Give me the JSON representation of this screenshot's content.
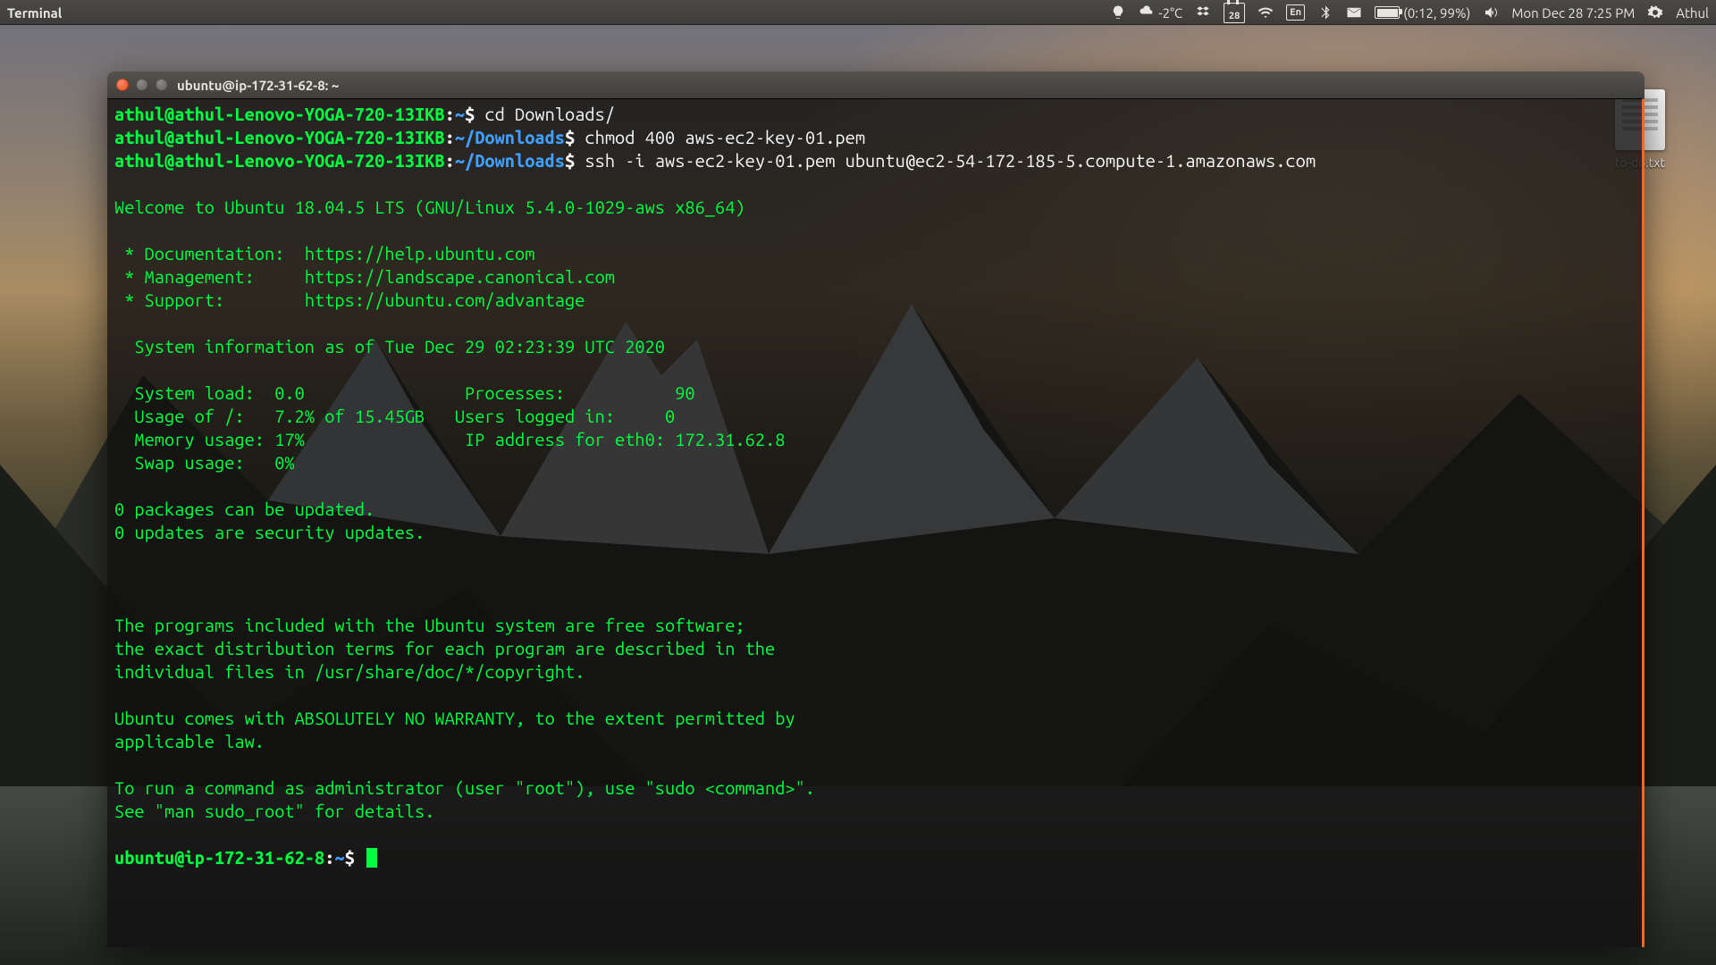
{
  "menubar": {
    "app_title": "Terminal",
    "indicators": {
      "temp": "-2°C",
      "calendar_day": "28",
      "kb_layout": "En",
      "battery_text": "(0:12, 99%)",
      "datetime": "Mon Dec 28  7:25 PM",
      "user": "Athul"
    }
  },
  "desktop": {
    "file_label": "to-do.txt"
  },
  "terminal": {
    "title": "ubuntu@ip-172-31-62-8: ~",
    "prompts": [
      {
        "user": "athul@athul-Lenovo-YOGA-720-13IKB",
        "path": "~",
        "cmd": "cd Downloads/"
      },
      {
        "user": "athul@athul-Lenovo-YOGA-720-13IKB",
        "path": "~/Downloads",
        "cmd": "chmod 400 aws-ec2-key-01.pem"
      },
      {
        "user": "athul@athul-Lenovo-YOGA-720-13IKB",
        "path": "~/Downloads",
        "cmd": "ssh -i aws-ec2-key-01.pem ubuntu@ec2-54-172-185-5.compute-1.amazonaws.com"
      }
    ],
    "motd": {
      "welcome": "Welcome to Ubuntu 18.04.5 LTS (GNU/Linux 5.4.0-1029-aws x86_64)",
      "links": {
        "doc_label": " * Documentation:",
        "doc_url": "https://help.ubuntu.com",
        "man_label": " * Management:",
        "man_url": "https://landscape.canonical.com",
        "sup_label": " * Support:",
        "sup_url": "https://ubuntu.com/advantage"
      },
      "sysinfo_header": "  System information as of Tue Dec 29 02:23:39 UTC 2020",
      "sysinfo": {
        "load_label": "  System load:",
        "load_val": "0.0",
        "proc_label": "Processes:",
        "proc_val": "90",
        "usage_label": "  Usage of /:",
        "usage_val": "7.2% of 15.45GB",
        "users_label": "Users logged in:",
        "users_val": "0",
        "mem_label": "  Memory usage:",
        "mem_val": "17%",
        "ip_label": "IP address for eth0:",
        "ip_val": "172.31.62.8",
        "swap_label": "  Swap usage:",
        "swap_val": "0%"
      },
      "updates_line1": "0 packages can be updated.",
      "updates_line2": "0 updates are security updates.",
      "legal1": "The programs included with the Ubuntu system are free software;",
      "legal2": "the exact distribution terms for each program are described in the",
      "legal3": "individual files in /usr/share/doc/*/copyright.",
      "legal4": "Ubuntu comes with ABSOLUTELY NO WARRANTY, to the extent permitted by",
      "legal5": "applicable law.",
      "sudo1": "To run a command as administrator (user \"root\"), use \"sudo <command>\".",
      "sudo2": "See \"man sudo_root\" for details."
    },
    "final_prompt": {
      "user": "ubuntu@ip-172-31-62-8",
      "path": "~"
    }
  }
}
